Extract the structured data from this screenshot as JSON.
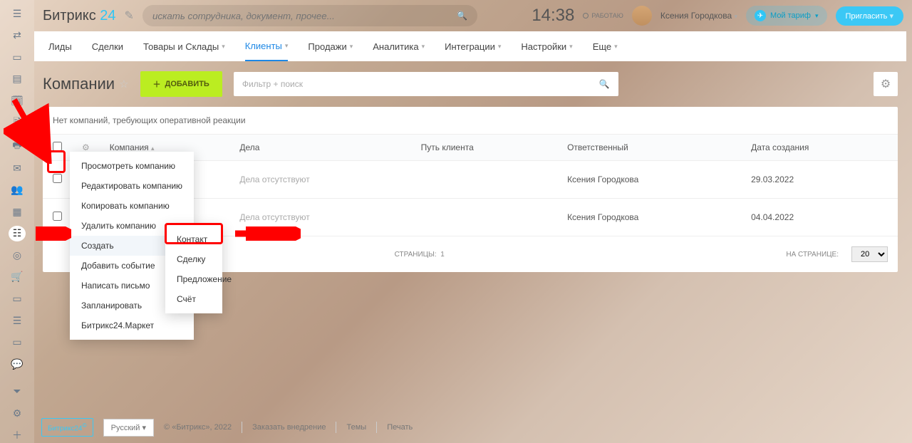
{
  "brand": {
    "part1": "Битрикс",
    "part2": "24"
  },
  "search_placeholder": "искать сотрудника, документ, прочее...",
  "clock": "14:38",
  "work_status": "РАБОТАЮ",
  "user": "Ксения Городкова",
  "tariff": "Мой тариф",
  "invite": "Пригласить",
  "nav": [
    "Лиды",
    "Сделки",
    "Товары и Склады",
    "Клиенты",
    "Продажи",
    "Аналитика",
    "Интеграции",
    "Настройки",
    "Еще"
  ],
  "nav_has_chev": [
    false,
    false,
    true,
    true,
    true,
    true,
    true,
    true,
    true
  ],
  "nav_active": 3,
  "title": "Компании",
  "add_btn": "ДОБАВИТЬ",
  "filter_ph": "Фильтр + поиск",
  "reaction": "Нет компаний, требующих оперативной реакции",
  "cols": {
    "company": "Компания",
    "deals": "Дела",
    "path": "Путь клиента",
    "resp": "Ответственный",
    "date": "Дата создания"
  },
  "rows": [
    {
      "deals": "Дела отсутствуют",
      "resp": "Ксения Городкова",
      "date": "29.03.2022"
    },
    {
      "deals": "Дела отсутствуют",
      "resp": "Ксения Городкова",
      "date": "04.04.2022"
    }
  ],
  "foot": {
    "pages_lbl": "СТРАНИЦЫ:",
    "pages": "1",
    "perpage_lbl": "НА СТРАНИЦЕ:",
    "perpage": "20"
  },
  "ctx1": [
    "Просмотреть компанию",
    "Редактировать компанию",
    "Копировать компанию",
    "Удалить компанию",
    "Создать",
    "Добавить событие",
    "Написать письмо",
    "Запланировать",
    "Битрикс24.Маркет"
  ],
  "ctx1_sub": [
    4,
    7
  ],
  "ctx2": [
    "Контакт",
    "Сделку",
    "Предложение",
    "Счёт"
  ],
  "bottom": {
    "brand": "Битрикс24",
    "lang": "Русский",
    "copy": "© «Битрикс», 2022",
    "impl": "Заказать внедрение",
    "themes": "Темы",
    "print": "Печать"
  }
}
